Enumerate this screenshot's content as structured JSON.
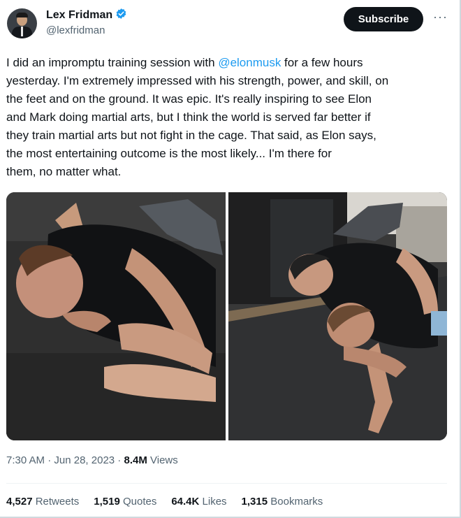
{
  "author": {
    "name": "Lex Fridman",
    "handle": "@lexfridman",
    "verified_color": "#1d9bf0"
  },
  "actions": {
    "subscribe_label": "Subscribe",
    "more_label": "···"
  },
  "tweet": {
    "lines": [
      {
        "before": "I did an impromptu training session with ",
        "mention": "@elonmusk",
        "after": " for a few hours"
      },
      {
        "text": "yesterday. I'm extremely impressed with his strength, power, and skill, on"
      },
      {
        "text": "the feet and on the ground. It was epic. It's really inspiring to see Elon"
      },
      {
        "text": "and Mark doing martial arts, but I think the world is served far better if"
      },
      {
        "text": "they train martial arts but not fight in the cage. That said, as Elon says,"
      },
      {
        "text": "the most entertaining outcome is the most likely... I'm there for"
      },
      {
        "text": "them, no matter what."
      }
    ]
  },
  "meta": {
    "time": "7:30 AM",
    "separator": " · ",
    "date": "Jun 28, 2023",
    "views_count": "8.4M",
    "views_label": " Views"
  },
  "stats": [
    {
      "count": "4,527",
      "label": " Retweets"
    },
    {
      "count": "1,519",
      "label": " Quotes"
    },
    {
      "count": "64.4K",
      "label": " Likes"
    },
    {
      "count": "1,315",
      "label": " Bookmarks"
    }
  ],
  "colors": {
    "accent": "#1d9bf0",
    "text": "#0f1419",
    "muted": "#536471"
  }
}
